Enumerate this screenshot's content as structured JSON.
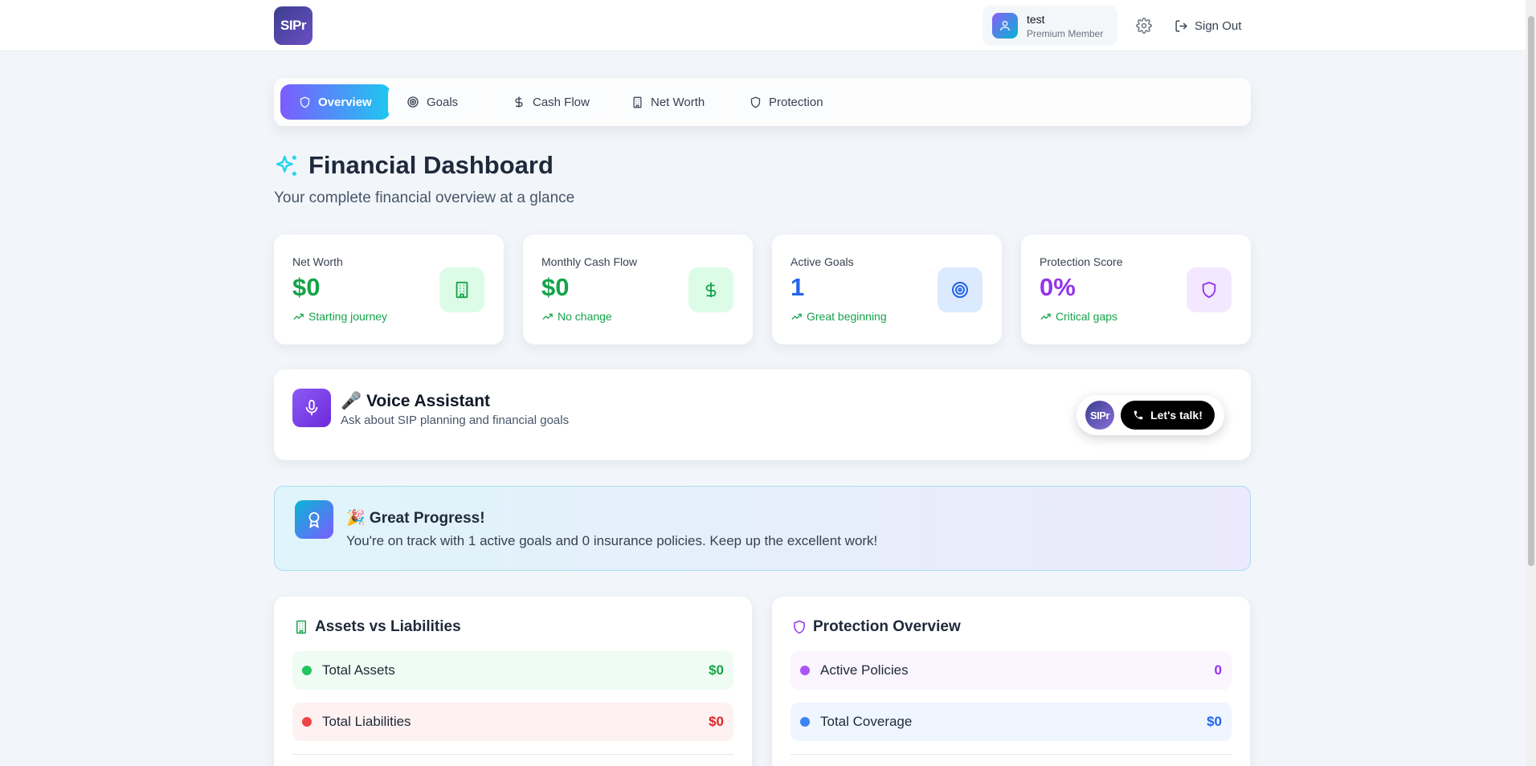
{
  "header": {
    "logo_text": "SIPr",
    "user_name": "test",
    "user_role": "Premium Member",
    "signout_label": "Sign Out"
  },
  "tabs": [
    {
      "label": "Overview",
      "icon": "shield-icon",
      "active": true
    },
    {
      "label": "Goals",
      "icon": "target-icon",
      "active": false
    },
    {
      "label": "Cash Flow",
      "icon": "dollar-icon",
      "active": false
    },
    {
      "label": "Net Worth",
      "icon": "building-icon",
      "active": false
    },
    {
      "label": "Protection",
      "icon": "shield-icon",
      "active": false
    }
  ],
  "page": {
    "title": "Financial Dashboard",
    "subtitle": "Your complete financial overview at a glance"
  },
  "stats": [
    {
      "label": "Net Worth",
      "value": "$0",
      "trend": "Starting journey",
      "icon": "building-icon",
      "value_color": "#16a34a",
      "icon_bg": "#dcfce7",
      "icon_color": "#16a34a"
    },
    {
      "label": "Monthly Cash Flow",
      "value": "$0",
      "trend": "No change",
      "icon": "dollar-icon",
      "value_color": "#16a34a",
      "icon_bg": "#dcfce7",
      "icon_color": "#16a34a"
    },
    {
      "label": "Active Goals",
      "value": "1",
      "trend": "Great beginning",
      "icon": "target-icon",
      "value_color": "#2563eb",
      "icon_bg": "#dbeafe",
      "icon_color": "#2563eb"
    },
    {
      "label": "Protection Score",
      "value": "0%",
      "trend": "Critical gaps",
      "icon": "shield-icon",
      "value_color": "#9333ea",
      "icon_bg": "#f3e8ff",
      "icon_color": "#9333ea"
    }
  ],
  "voice": {
    "title": "🎤 Voice Assistant",
    "subtitle": "Ask about SIP planning and financial goals",
    "avatar_text": "SIPr",
    "talk_label": "Let's talk!"
  },
  "progress": {
    "title": "🎉 Great Progress!",
    "text": "You're on track with 1 active goals and 0 insurance policies. Keep up the excellent work!"
  },
  "assets_panel": {
    "title": "Assets vs Liabilities",
    "rows": [
      {
        "label": "Total Assets",
        "value": "$0",
        "dot": "#22c55e",
        "bg": "#effcf3",
        "value_color": "#16a34a"
      },
      {
        "label": "Total Liabilities",
        "value": "$0",
        "dot": "#ef4444",
        "bg": "#fef1f1",
        "value_color": "#dc2626"
      }
    ]
  },
  "protection_panel": {
    "title": "Protection Overview",
    "rows": [
      {
        "label": "Active Policies",
        "value": "0",
        "dot": "#a855f7",
        "bg": "#faf5ff",
        "value_color": "#9333ea"
      },
      {
        "label": "Total Coverage",
        "value": "$0",
        "dot": "#3b82f6",
        "bg": "#eff6ff",
        "value_color": "#2563eb"
      }
    ]
  }
}
